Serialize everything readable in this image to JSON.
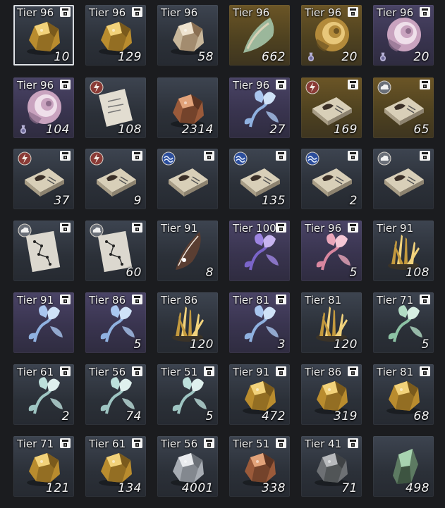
{
  "inventory": {
    "rows": [
      [
        {
          "tier": "Tier 96",
          "qty": "10",
          "icon": "gold-ore-icon",
          "bg": "dark",
          "lock": true,
          "selected": true
        },
        {
          "tier": "Tier 96",
          "qty": "129",
          "icon": "gold-ore-icon",
          "bg": "dark",
          "lock": true
        },
        {
          "tier": "Tier 96",
          "qty": "58",
          "icon": "stone-ore-icon",
          "bg": "dark",
          "lock": false
        },
        {
          "tier": "Tier 96",
          "qty": "662",
          "icon": "scale-icon",
          "bg": "gold",
          "lock": false
        },
        {
          "tier": "Tier 96",
          "qty": "20",
          "icon": "gold-shell-icon",
          "bg": "gold",
          "lock": true,
          "badge_bottom": "potion-badge-icon"
        },
        {
          "tier": "Tier 96",
          "qty": "20",
          "icon": "pink-shell-icon",
          "bg": "purple",
          "lock": true,
          "badge_bottom": "potion-badge-icon"
        }
      ],
      [
        {
          "tier": "Tier 96",
          "qty": "104",
          "icon": "pink-shell-icon",
          "bg": "purple",
          "lock": true,
          "badge_bottom": "potion-badge-icon"
        },
        {
          "tier": "",
          "qty": "108",
          "icon": "scroll-icon",
          "bg": "dark",
          "lock": false,
          "badge": "lightning-badge-icon"
        },
        {
          "tier": "",
          "qty": "2314",
          "icon": "copper-ore-icon",
          "bg": "dark",
          "lock": false
        },
        {
          "tier": "Tier 96",
          "qty": "27",
          "icon": "blue-flower-icon",
          "bg": "purple",
          "lock": true
        },
        {
          "tier": "",
          "qty": "169",
          "icon": "recipe-book-icon",
          "bg": "gold",
          "lock": true,
          "badge": "lightning-badge-icon"
        },
        {
          "tier": "",
          "qty": "65",
          "icon": "recipe-book-icon",
          "bg": "gold",
          "lock": true,
          "badge": "cloud-badge-icon"
        }
      ],
      [
        {
          "tier": "",
          "qty": "37",
          "icon": "recipe-book-icon",
          "bg": "dark",
          "lock": true,
          "badge": "lightning-badge-icon"
        },
        {
          "tier": "",
          "qty": "9",
          "icon": "recipe-book-icon",
          "bg": "dark",
          "lock": true,
          "badge": "lightning-badge-icon"
        },
        {
          "tier": "",
          "qty": "",
          "icon": "recipe-book-icon",
          "bg": "dark",
          "lock": true,
          "badge": "wave-badge-icon"
        },
        {
          "tier": "",
          "qty": "135",
          "icon": "recipe-book-icon",
          "bg": "dark",
          "lock": true,
          "badge": "wave-badge-icon"
        },
        {
          "tier": "",
          "qty": "2",
          "icon": "recipe-book-icon",
          "bg": "dark",
          "lock": true,
          "badge": "wave-badge-icon"
        },
        {
          "tier": "",
          "qty": "",
          "icon": "recipe-book-icon",
          "bg": "dark",
          "lock": true,
          "badge": "cloud-badge-icon"
        }
      ],
      [
        {
          "tier": "",
          "qty": "",
          "icon": "map-icon",
          "bg": "dark",
          "lock": true,
          "badge": "cloud-badge-icon"
        },
        {
          "tier": "",
          "qty": "60",
          "icon": "map-icon",
          "bg": "dark",
          "lock": true,
          "badge": "cloud-badge-icon"
        },
        {
          "tier": "Tier 91",
          "qty": "8",
          "icon": "feather-icon",
          "bg": "dark",
          "lock": false
        },
        {
          "tier": "Tier 100",
          "qty": "",
          "icon": "purple-flower-icon",
          "bg": "purple",
          "lock": true
        },
        {
          "tier": "Tier 96",
          "qty": "5",
          "icon": "pink-flower-icon",
          "bg": "purple",
          "lock": true
        },
        {
          "tier": "Tier 91",
          "qty": "108",
          "icon": "gold-crystal-icon",
          "bg": "dark",
          "lock": false
        }
      ],
      [
        {
          "tier": "Tier 91",
          "qty": "",
          "icon": "blue-flower-icon",
          "bg": "purple",
          "lock": true
        },
        {
          "tier": "Tier 86",
          "qty": "5",
          "icon": "blue-flower-icon",
          "bg": "purple",
          "lock": true
        },
        {
          "tier": "Tier 86",
          "qty": "120",
          "icon": "gold-crystal-icon",
          "bg": "dark",
          "lock": false
        },
        {
          "tier": "Tier 81",
          "qty": "3",
          "icon": "blue-flower-icon",
          "bg": "purple",
          "lock": true
        },
        {
          "tier": "Tier 81",
          "qty": "120",
          "icon": "gold-crystal-icon",
          "bg": "dark",
          "lock": false
        },
        {
          "tier": "Tier 71",
          "qty": "5",
          "icon": "green-flower-icon",
          "bg": "dark",
          "lock": true
        }
      ],
      [
        {
          "tier": "Tier 61",
          "qty": "2",
          "icon": "teal-flower-icon",
          "bg": "dark",
          "lock": true
        },
        {
          "tier": "Tier 56",
          "qty": "74",
          "icon": "teal-flower-icon",
          "bg": "dark",
          "lock": true
        },
        {
          "tier": "Tier 51",
          "qty": "5",
          "icon": "teal-flower-icon",
          "bg": "dark",
          "lock": true
        },
        {
          "tier": "Tier 91",
          "qty": "472",
          "icon": "gold-ore-icon",
          "bg": "dark",
          "lock": true
        },
        {
          "tier": "Tier 86",
          "qty": "319",
          "icon": "gold-ore-icon",
          "bg": "dark",
          "lock": true
        },
        {
          "tier": "Tier 81",
          "qty": "68",
          "icon": "gold-ore-icon",
          "bg": "dark",
          "lock": true
        }
      ],
      [
        {
          "tier": "Tier 71",
          "qty": "121",
          "icon": "gold-ore-icon",
          "bg": "dark",
          "lock": true
        },
        {
          "tier": "Tier 61",
          "qty": "134",
          "icon": "gold-ore-icon",
          "bg": "dark",
          "lock": true
        },
        {
          "tier": "Tier 56",
          "qty": "4001",
          "icon": "silver-ore-icon",
          "bg": "dark",
          "lock": true
        },
        {
          "tier": "Tier 51",
          "qty": "338",
          "icon": "copper-ore-icon",
          "bg": "dark",
          "lock": true
        },
        {
          "tier": "Tier 41",
          "qty": "71",
          "icon": "iron-ore-icon",
          "bg": "dark",
          "lock": true
        },
        {
          "tier": "",
          "qty": "498",
          "icon": "green-crystal-icon",
          "bg": "dark",
          "lock": false
        }
      ]
    ]
  }
}
